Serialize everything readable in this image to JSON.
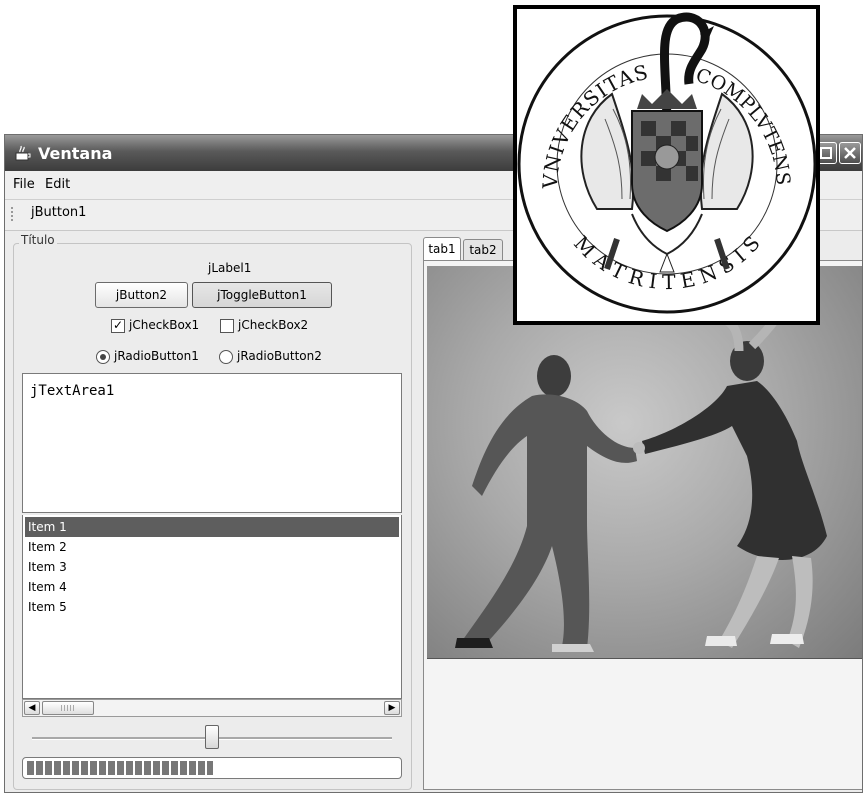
{
  "window": {
    "title": "Ventana"
  },
  "menu": {
    "items": [
      "File",
      "Edit"
    ]
  },
  "toolbar": {
    "button_label": "jButton1"
  },
  "left_panel": {
    "border_title": "Título",
    "label": "jLabel1",
    "button_label": "jButton2",
    "toggle_label": "jToggleButton1",
    "checkbox1": {
      "label": "jCheckBox1",
      "checked": true
    },
    "checkbox2": {
      "label": "jCheckBox2",
      "checked": false
    },
    "radio1": {
      "label": "jRadioButton1",
      "selected": true
    },
    "radio2": {
      "label": "jRadioButton2",
      "selected": false
    },
    "textarea_text": "jTextArea1",
    "list_items": [
      "Item 1",
      "Item 2",
      "Item 3",
      "Item 4",
      "Item 5"
    ],
    "selected_index": 0,
    "slider_value": 0.5,
    "progress_value": 0.5
  },
  "tabs": {
    "labels": [
      "tab1",
      "tab2"
    ],
    "active": 0
  },
  "logo": {
    "text_left": "VNIVERSITAS",
    "text_right": "COMPLVTENSIS",
    "text_bottom": [
      "M",
      "A",
      "T",
      "R",
      "I",
      "T",
      "E",
      "N",
      "S",
      "I",
      "S"
    ]
  },
  "colors": {
    "titlebar": "#4a4a4a",
    "selection": "#5e5e5e",
    "panel_bg": "#ececec"
  }
}
